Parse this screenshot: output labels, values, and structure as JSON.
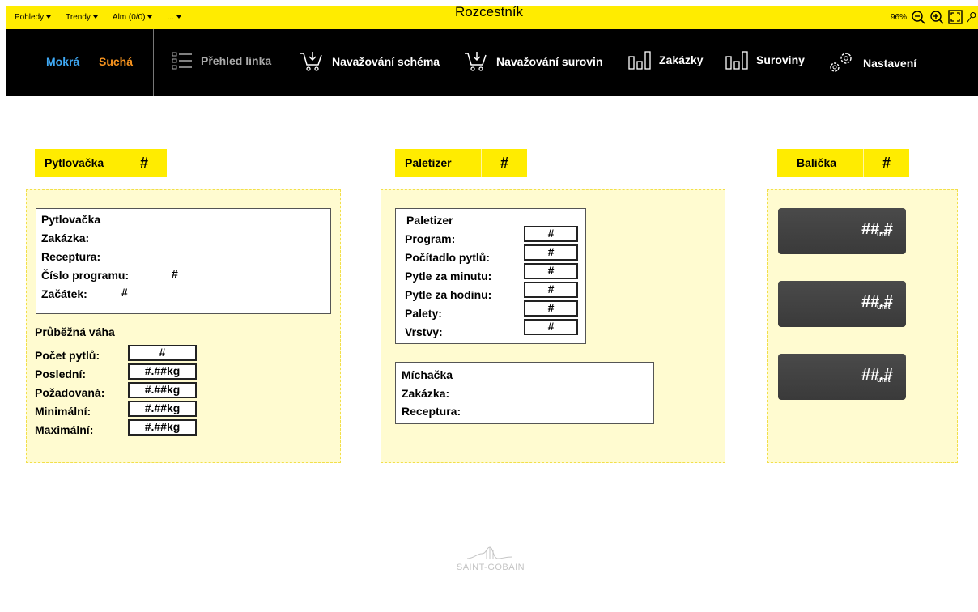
{
  "topbar": {
    "menus": [
      "Pohledy",
      "Trendy",
      "Alm (0/0)",
      "..."
    ],
    "title": "Rozcestník",
    "zoom_level": "96%"
  },
  "navbar": {
    "modes": [
      {
        "label": "Mokrá",
        "color": "#3fa9f5"
      },
      {
        "label": "Suchá",
        "color": "#f7931e"
      }
    ],
    "items": [
      {
        "label": "Přehled linka",
        "icon": "list-icon"
      },
      {
        "label": "Navažování schéma",
        "icon": "cart-icon"
      },
      {
        "label": "Navažování surovin",
        "icon": "cart-icon"
      },
      {
        "label": "Zakázky",
        "icon": "bar-chart-icon"
      },
      {
        "label": "Suroviny",
        "icon": "bar-chart-icon"
      },
      {
        "label": "Nastavení",
        "icon": "gears-icon"
      }
    ]
  },
  "sections": {
    "pytlovacka": {
      "tab_label": "Pytlovačka",
      "tab_value": "#",
      "info": {
        "title": "Pytlovačka",
        "rows": [
          {
            "label": "Zakázka:",
            "value": ""
          },
          {
            "label": "Receptura:",
            "value": ""
          },
          {
            "label": "Číslo programu:",
            "value": "#"
          },
          {
            "label": "Začátek:",
            "value": "#"
          }
        ]
      },
      "scale": {
        "title": "Průběžná váha",
        "rows": [
          {
            "label": "Počet pytlů:",
            "value": "#"
          },
          {
            "label": "Poslední:",
            "value": "#.##kg"
          },
          {
            "label": "Požadovaná:",
            "value": "#.##kg"
          },
          {
            "label": "Minimální:",
            "value": "#.##kg"
          },
          {
            "label": "Maximální:",
            "value": "#.##kg"
          }
        ]
      }
    },
    "paletizer": {
      "tab_label": "Paletizer",
      "tab_value": "#",
      "info": {
        "title": "Paletizer",
        "rows": [
          {
            "label": "Program:",
            "value": "#"
          },
          {
            "label": "Počítadlo pytlů:",
            "value": "#"
          },
          {
            "label": "Pytle za minutu:",
            "value": "#"
          },
          {
            "label": "Pytle za hodinu:",
            "value": "#"
          },
          {
            "label": "Palety:",
            "value": "#"
          },
          {
            "label": "Vrstvy:",
            "value": "#"
          }
        ]
      },
      "mixer": {
        "title": "Míchačka",
        "rows": [
          {
            "label": "Zakázka:"
          },
          {
            "label": "Receptura:"
          }
        ]
      }
    },
    "balicka": {
      "tab_label": "Balička",
      "tab_value": "#",
      "gauges": [
        {
          "value": "##.#",
          "unit": "unit"
        },
        {
          "value": "##.#",
          "unit": "unit"
        },
        {
          "value": "##.#",
          "unit": "unit"
        }
      ]
    }
  },
  "footer": {
    "logo_text": "SAINT-GOBAIN"
  }
}
